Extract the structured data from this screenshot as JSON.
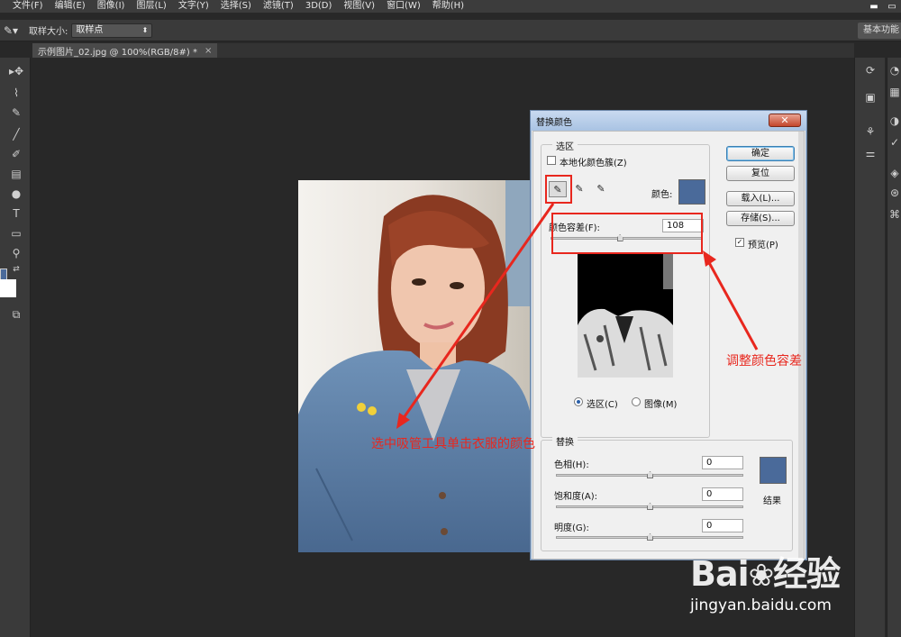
{
  "menu": [
    "文件(F)",
    "编辑(E)",
    "图像(I)",
    "图层(L)",
    "文字(Y)",
    "选择(S)",
    "滤镜(T)",
    "3D(D)",
    "视图(V)",
    "窗口(W)",
    "帮助(H)"
  ],
  "options_bar": {
    "sample_size_label": "取样大小:",
    "sample_size_value": "取样点",
    "workspace": "基本功能"
  },
  "document_tab": {
    "title": "示例图片_02.jpg @ 100%(RGB/8#) *",
    "close": "×"
  },
  "dialog": {
    "title": "替换颜色",
    "close": "✕",
    "selection_group": "选区",
    "localized_clusters": "本地化颜色簇(Z)",
    "color_label": "颜色:",
    "fuzziness_label": "颜色容差(F):",
    "fuzziness_value": "108",
    "fuzziness_fraction": 0.45,
    "radio_selection": "选区(C)",
    "radio_image": "图像(M)",
    "selected_color": "#4a6a9a",
    "buttons": {
      "ok": "确定",
      "reset": "复位",
      "load": "载入(L)...",
      "save": "存储(S)...",
      "preview": "预览(P)"
    },
    "replacement_group": "替换",
    "hue_label": "色相(H):",
    "hue_value": "0",
    "saturation_label": "饱和度(A):",
    "saturation_value": "0",
    "lightness_label": "明度(G):",
    "lightness_value": "0",
    "result_label": "结果",
    "result_color": "#4a6a9a"
  },
  "annotations": {
    "eyedropper_note": "选中吸管工具单击衣服的颜色",
    "tolerance_note": "调整颜色容差",
    "accent": "#e8271e"
  },
  "watermark": {
    "brand": "Bai",
    "paw": "❀",
    "site_cn": "经验",
    "url": "jingyan.baidu.com"
  }
}
